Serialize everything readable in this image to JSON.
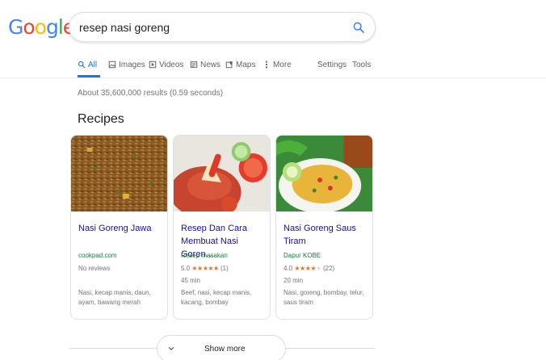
{
  "logo": {
    "letters": [
      "G",
      "o",
      "o",
      "g",
      "l",
      "e"
    ],
    "colors": [
      "#4285F4",
      "#EA4335",
      "#FBBC05",
      "#4285F4",
      "#34A853",
      "#EA4335"
    ]
  },
  "search": {
    "query": "resep nasi goreng",
    "icon": "search-icon",
    "accent": "#4285F4"
  },
  "tabs": [
    {
      "label": "All",
      "icon": "search-icon",
      "active": true
    },
    {
      "label": "Images",
      "icon": "image-icon"
    },
    {
      "label": "Videos",
      "icon": "video-icon"
    },
    {
      "label": "News",
      "icon": "news-icon"
    },
    {
      "label": "Maps",
      "icon": "map-icon"
    },
    {
      "label": "More",
      "icon": "more-dots-icon"
    },
    {
      "label": "Settings"
    },
    {
      "label": "Tools"
    }
  ],
  "stats": "About 35,600,000 results (0.59 seconds)",
  "section_title": "Recipes",
  "cards": [
    {
      "title": "Nasi Goreng Jawa",
      "source": "cookpad.com",
      "reviews": "No reviews",
      "ingredients": "Nasi, kecap manis, daun, ayam, bawang merah"
    },
    {
      "title": "Resep Dan Cara Membuat Nasi Goren…",
      "source": "Resep masakan",
      "rating": "5.0",
      "stars": 5,
      "rating_count": "(1)",
      "time": "45 min",
      "ingredients": "Beef, nasi, kecap manis, kacang, bombay"
    },
    {
      "title": "Nasi Goreng Saus Tiram",
      "source": "Dapur KOBE",
      "rating": "4.0",
      "stars": 4,
      "rating_count": "(22)",
      "time": "20 min",
      "ingredients": "Nasi, goreng, bombay, telur, saus tiram"
    }
  ],
  "show_more": {
    "label": "Show more",
    "icon": "chevron-down-icon"
  },
  "colors": {
    "link": "#1a0dab",
    "url": "#188038",
    "star": "#e7711b",
    "tab_active": "#1a73e8"
  }
}
